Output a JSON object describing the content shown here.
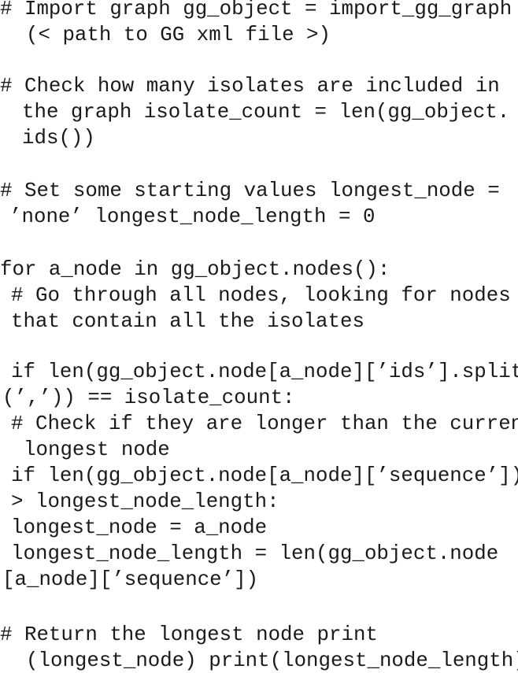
{
  "code_block": {
    "language": "python",
    "lines": [
      {
        "text": "# Import graph gg_object = import_gg_graph",
        "kind": "comment"
      },
      {
        "text": "(< path to GG xml file >)",
        "kind": "comment-continuation"
      },
      {
        "text": "# Check how many isolates are included in",
        "kind": "comment"
      },
      {
        "text": "the graph isolate_count = len(gg_object.",
        "kind": "comment-continuation"
      },
      {
        "text": "ids())",
        "kind": "comment-continuation"
      },
      {
        "text": "# Set some starting values longest_node =",
        "kind": "comment"
      },
      {
        "text": "’none’ longest_node_length = 0",
        "kind": "comment-continuation"
      },
      {
        "text": "for a_node in gg_object.nodes():",
        "kind": "code"
      },
      {
        "text": "# Go through all nodes, looking for nodes",
        "kind": "comment"
      },
      {
        "text": "that contain all the isolates",
        "kind": "comment-continuation"
      },
      {
        "text": "if len(gg_object.node[a_node][’ids’].split",
        "kind": "code"
      },
      {
        "text": "(’,’)) == isolate_count:",
        "kind": "code-continuation"
      },
      {
        "text": "# Check if they are longer than the current",
        "kind": "comment"
      },
      {
        "text": "longest node",
        "kind": "comment-continuation"
      },
      {
        "text": "if len(gg_object.node[a_node][’sequence’])",
        "kind": "code"
      },
      {
        "text": "> longest_node_length:",
        "kind": "code-continuation"
      },
      {
        "text": "longest_node = a_node",
        "kind": "code"
      },
      {
        "text": "longest_node_length = len(gg_object.node",
        "kind": "code"
      },
      {
        "text": "[a_node][’sequence’])",
        "kind": "code-continuation"
      },
      {
        "text": "# Return the longest node print",
        "kind": "comment"
      },
      {
        "text": "(longest_node) print(longest_node_length)",
        "kind": "comment-continuation"
      }
    ]
  }
}
